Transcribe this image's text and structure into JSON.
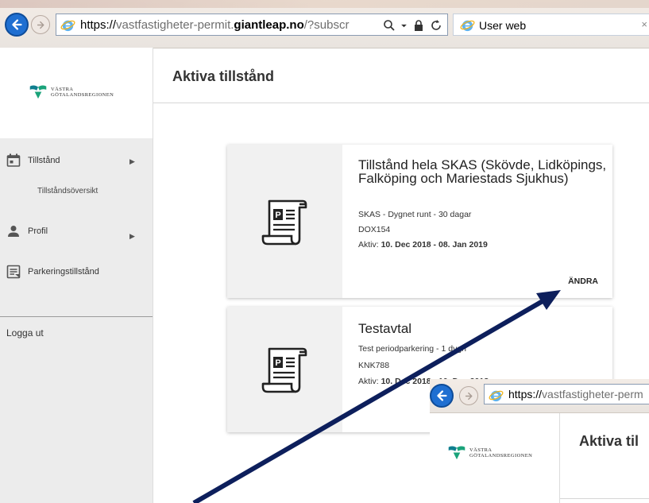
{
  "browser": {
    "url_scheme": "https://",
    "url_host_pre": "vastfastigheter-permit.",
    "url_host_bold": "giantleap.no",
    "url_rest": "/?subscr",
    "tab_title": "User web",
    "tab_close": "×"
  },
  "sidebar": {
    "logo_line1": "VÄSTRA",
    "logo_line2": "GÖTALANDSREGIONEN",
    "items": [
      {
        "label": "Tillstånd",
        "icon": "calendar-icon",
        "has_caret": true
      },
      {
        "label": "Profil",
        "icon": "person-icon",
        "has_caret": true
      },
      {
        "label": "Parkeringstillstånd",
        "icon": "document-icon",
        "has_caret": false
      }
    ],
    "subitem": "Tillståndsöversikt",
    "caret": "▶",
    "logout": "Logga ut"
  },
  "main": {
    "title": "Aktiva tillstånd",
    "cards": [
      {
        "title": "Tillstånd hela SKAS (Skövde, Lidköpings, Falköping och Mariestads Sjukhus)",
        "line1": "SKAS - Dygnet runt - 30 dagar",
        "line2": "DOX154",
        "active_prefix": "Aktiv: ",
        "active_range": "10. Dec 2018 - 08. Jan 2019",
        "edit_label": "ÄNDRA",
        "icon": "parking-ticket-icon"
      },
      {
        "title": "Testavtal",
        "line1": "Test periodparkering - 1 dygn",
        "line2": "KNK788",
        "active_prefix": "Aktiv: ",
        "active_range": "10. Dec 2018 - 10. Dec 2018",
        "icon": "parking-ticket-icon"
      }
    ]
  },
  "inset": {
    "url_scheme": "https://",
    "url_host": "vastfastigheter-perm",
    "logo_line1": "VÄSTRA",
    "logo_line2": "GÖTALANDSREGIONEN",
    "title": "Aktiva til"
  },
  "colors": {
    "accent_blue": "#1f6fd1",
    "arrow": "#0d1f5c",
    "logo_green": "#1aa37a",
    "logo_teal": "#0f7f8f"
  }
}
